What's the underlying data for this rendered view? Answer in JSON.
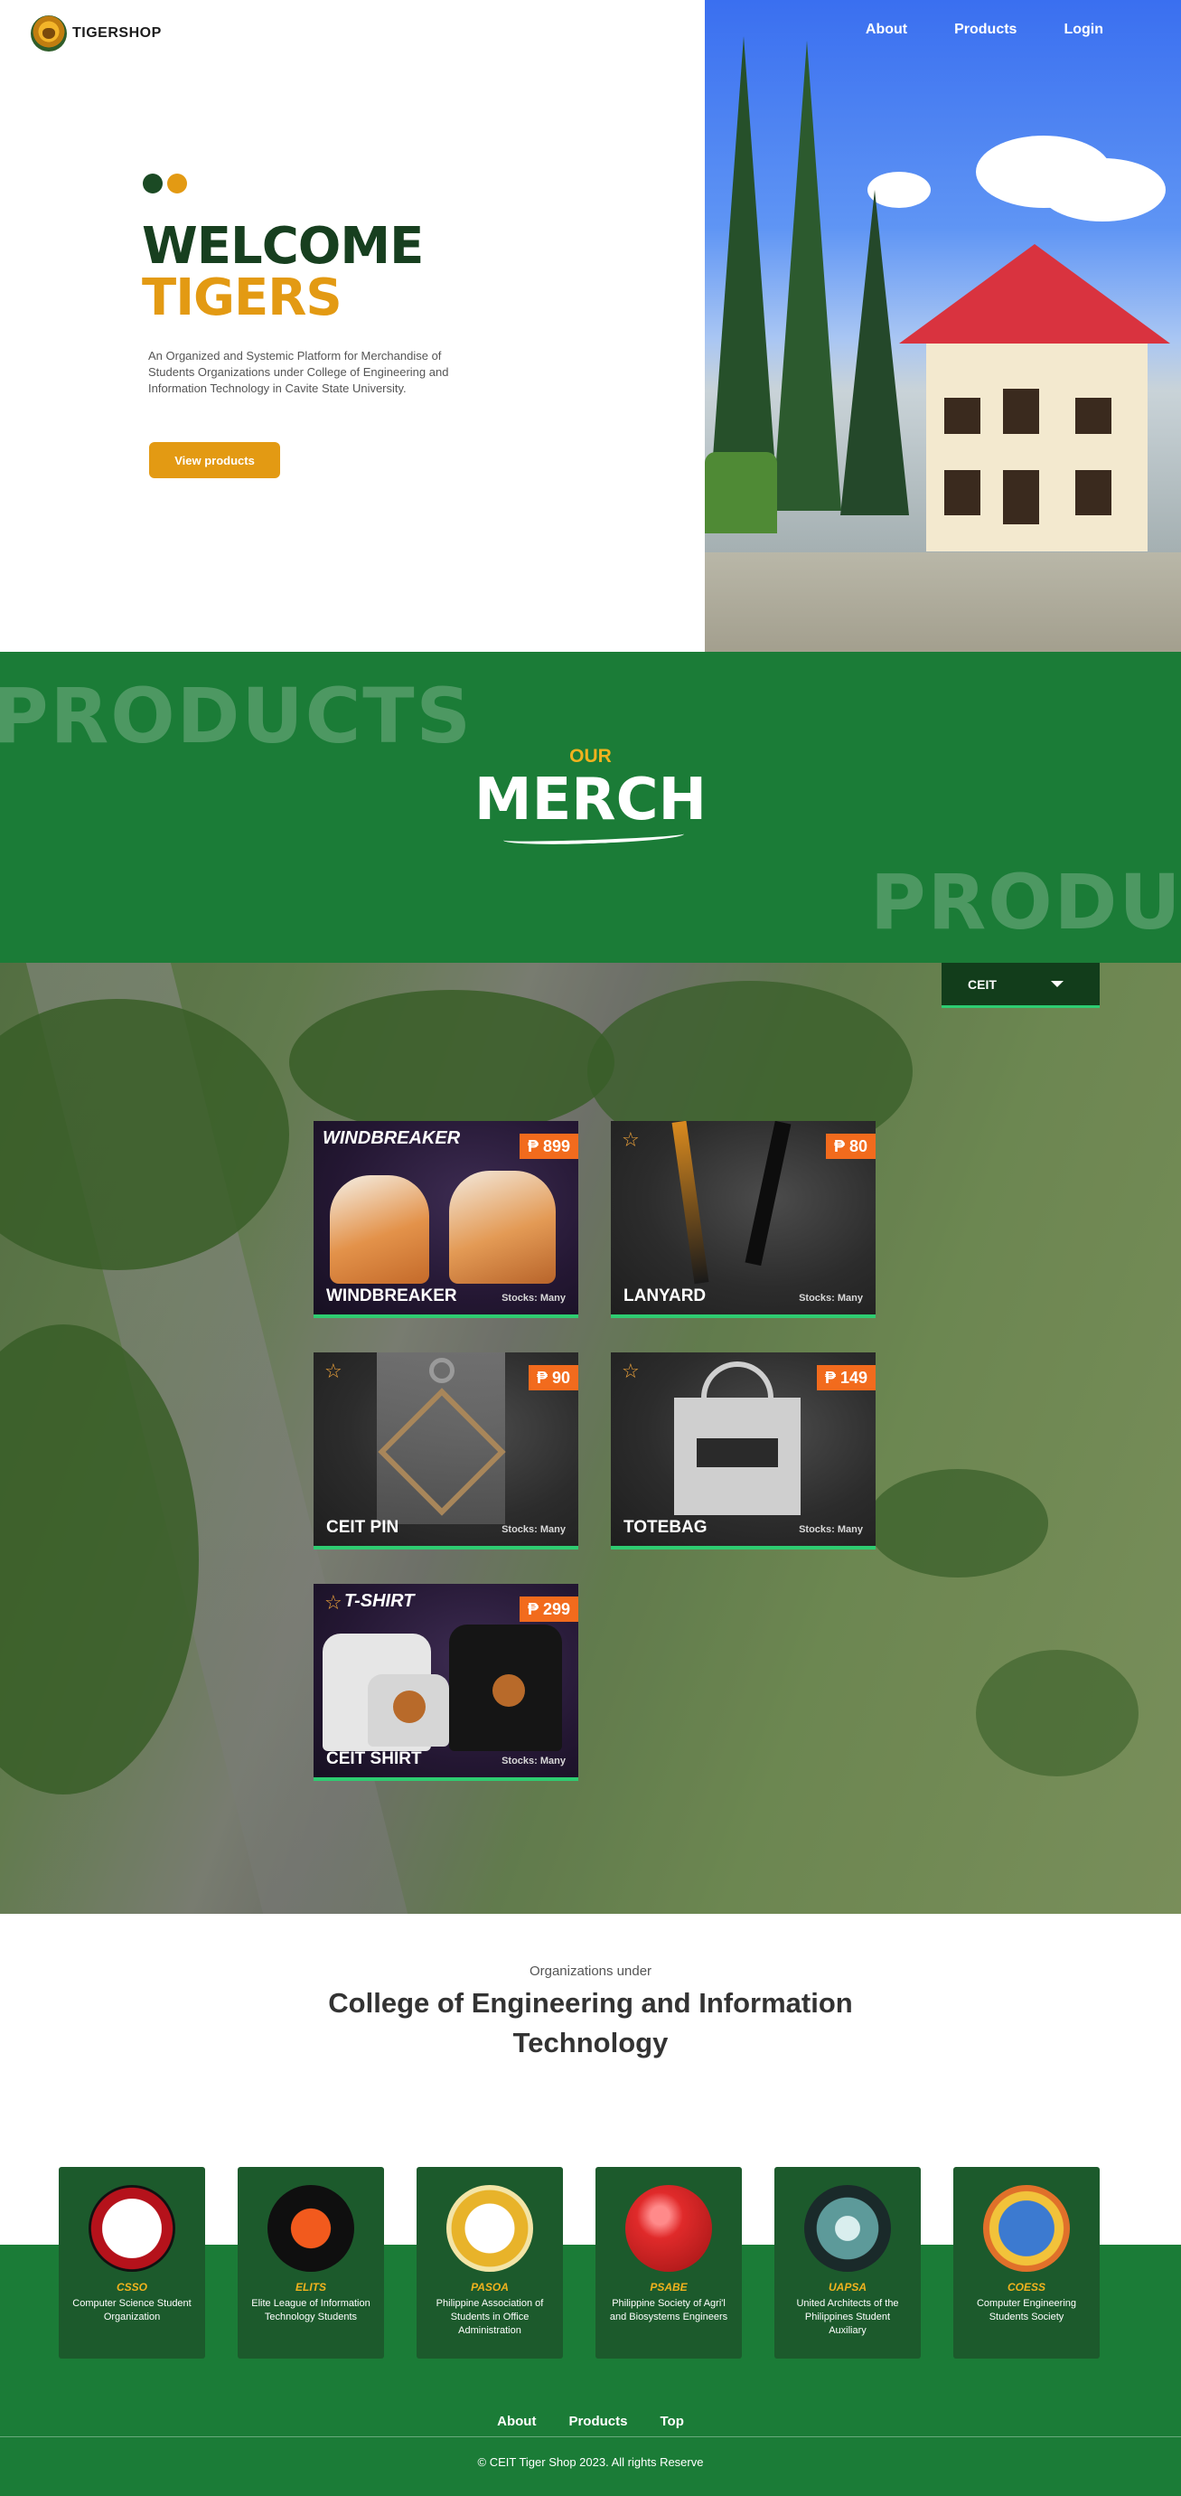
{
  "brand": {
    "name": "TIGERSHOP"
  },
  "nav": {
    "about": "About",
    "products": "Products",
    "login": "Login"
  },
  "hero": {
    "welcome": "WELCOME",
    "tigers": "TIGERS",
    "description": "An Organized and Systemic Platform for Merchandise of Students Organizations under College of Engineering and Information Technology in Cavite State University.",
    "cta_label": "View products"
  },
  "merch": {
    "ghost_text_1": "PRODUCTS",
    "ghost_text_2": "PRODUCTS",
    "eyebrow": "OUR",
    "title": "MERCH"
  },
  "filter": {
    "selected": "CEIT"
  },
  "products": [
    {
      "name": "WINDBREAKER",
      "price": "₱ 899",
      "stock": "Stocks: Many",
      "banner": "WINDBREAKER"
    },
    {
      "name": "LANYARD",
      "price": "₱ 80",
      "stock": "Stocks: Many"
    },
    {
      "name": "CEIT PIN",
      "price": "₱ 90",
      "stock": "Stocks: Many"
    },
    {
      "name": "TOTEBAG",
      "price": "₱ 149",
      "stock": "Stocks: Many"
    },
    {
      "name": "CEIT SHIRT",
      "price": "₱ 299",
      "stock": "Stocks: Many",
      "banner": "T-SHIRT"
    }
  ],
  "orgs": {
    "pre_title": "Organizations under",
    "title": "College of Engineering and Information Technology",
    "items": [
      {
        "abbr": "CSSO",
        "name": "Computer Science Student Organization",
        "color": "#b5121b"
      },
      {
        "abbr": "ELITS",
        "name": "Elite League of Information Technology Students",
        "color": "#f25a1d"
      },
      {
        "abbr": "PASOA",
        "name": "Philippine Association of Students in Office Administration",
        "color": "#d9a21a"
      },
      {
        "abbr": "PSABE",
        "name": "Philippine Society of Agri'l and Biosystems Engineers",
        "color": "#d92a2a"
      },
      {
        "abbr": "UAPSA",
        "name": "United Architects of the Philippines Student Auxiliary",
        "color": "#3f6f6f"
      },
      {
        "abbr": "COESS",
        "name": "Computer Engineering Students Society",
        "color": "#e0702a"
      }
    ]
  },
  "footer": {
    "about": "About",
    "products": "Products",
    "top": "Top",
    "copyright": "© CEIT Tiger Shop 2023. All rights Reserve"
  }
}
